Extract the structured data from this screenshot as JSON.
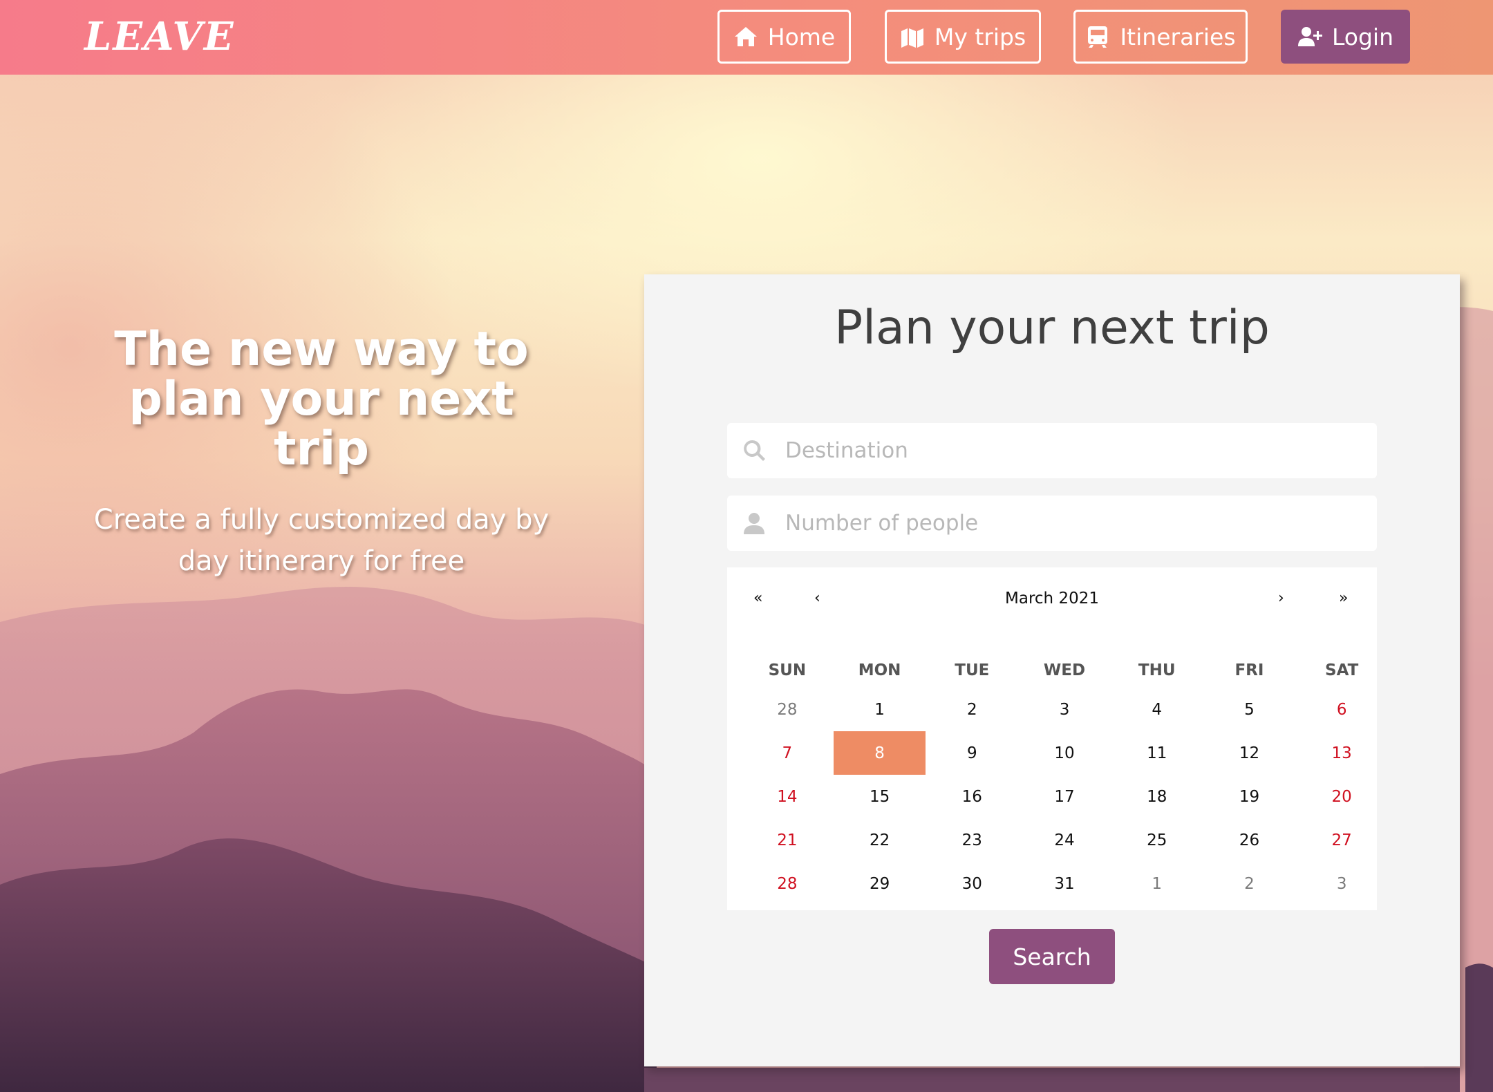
{
  "brand": {
    "logo": "LEAVE"
  },
  "nav": {
    "home": {
      "label": "Home",
      "icon": "home-icon"
    },
    "trips": {
      "label": "My trips",
      "icon": "map-icon"
    },
    "itineraries": {
      "label": "Itineraries",
      "icon": "train-icon"
    },
    "login": {
      "label": "Login",
      "icon": "user-plus-icon"
    }
  },
  "hero": {
    "title": "The new way to plan your next trip",
    "subtitle": "Create a fully customized day by day itinerary for free"
  },
  "planner": {
    "title": "Plan your next trip",
    "destination": {
      "placeholder": "Destination",
      "value": "",
      "icon": "search-icon"
    },
    "people": {
      "placeholder": "Number of people",
      "value": "",
      "icon": "user-icon"
    },
    "calendar": {
      "month_label": "March 2021",
      "nav": {
        "prev_year": "«",
        "prev_month": "‹",
        "next_month": "›",
        "next_year": "»"
      },
      "weekdays": [
        "SUN",
        "MON",
        "TUE",
        "WED",
        "THU",
        "FRI",
        "SAT"
      ],
      "weeks": [
        [
          {
            "d": "28",
            "t": "other"
          },
          {
            "d": "1"
          },
          {
            "d": "2"
          },
          {
            "d": "3"
          },
          {
            "d": "4"
          },
          {
            "d": "5"
          },
          {
            "d": "6",
            "t": "weekend"
          }
        ],
        [
          {
            "d": "7",
            "t": "weekend"
          },
          {
            "d": "8",
            "t": "selected"
          },
          {
            "d": "9"
          },
          {
            "d": "10"
          },
          {
            "d": "11"
          },
          {
            "d": "12"
          },
          {
            "d": "13",
            "t": "weekend"
          }
        ],
        [
          {
            "d": "14",
            "t": "weekend"
          },
          {
            "d": "15"
          },
          {
            "d": "16"
          },
          {
            "d": "17"
          },
          {
            "d": "18"
          },
          {
            "d": "19"
          },
          {
            "d": "20",
            "t": "weekend"
          }
        ],
        [
          {
            "d": "21",
            "t": "weekend"
          },
          {
            "d": "22"
          },
          {
            "d": "23"
          },
          {
            "d": "24"
          },
          {
            "d": "25"
          },
          {
            "d": "26"
          },
          {
            "d": "27",
            "t": "weekend"
          }
        ],
        [
          {
            "d": "28",
            "t": "weekend"
          },
          {
            "d": "29"
          },
          {
            "d": "30"
          },
          {
            "d": "31"
          },
          {
            "d": "1",
            "t": "other"
          },
          {
            "d": "2",
            "t": "other"
          },
          {
            "d": "3",
            "t": "other"
          }
        ]
      ],
      "selected_date": "8"
    },
    "search_label": "Search"
  },
  "colors": {
    "header_start": "#f67b8a",
    "header_end": "#ee9673",
    "accent_purple": "#8e4f7e",
    "selected_day": "#ee8c64",
    "weekend_red": "#d01020"
  }
}
